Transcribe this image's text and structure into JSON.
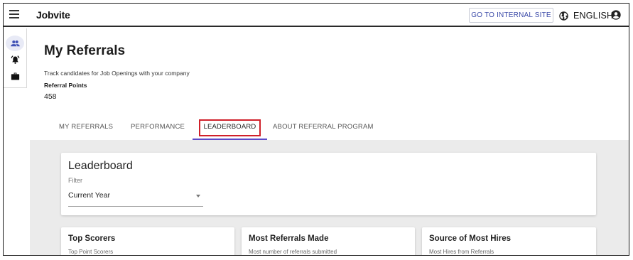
{
  "header": {
    "brand": "Jobvite",
    "internal_site_label": "GO TO INTERNAL SITE",
    "language_label": "ENGLISH"
  },
  "icons": {
    "menu": "hamburger-icon",
    "language": "globe-icon",
    "account": "account-circle-icon",
    "nav_referrals": "people-icon",
    "nav_alerts": "alarm-icon",
    "nav_jobs": "briefcase-icon"
  },
  "page": {
    "title": "My Referrals",
    "subtitle": "Track candidates for Job Openings with your company",
    "points_label": "Referral Points",
    "points_value": "458"
  },
  "tabs": [
    {
      "label": "MY REFERRALS"
    },
    {
      "label": "PERFORMANCE"
    },
    {
      "label": "LEADERBOARD"
    },
    {
      "label": "ABOUT REFERRAL PROGRAM"
    }
  ],
  "active_tab": "LEADERBOARD",
  "leaderboard": {
    "title": "Leaderboard",
    "filter_label": "Filter",
    "filter_value": "Current Year"
  },
  "stats": [
    {
      "title": "Top Scorers",
      "subtitle": "Top Point Scorers"
    },
    {
      "title": "Most Referrals Made",
      "subtitle": "Most number of referrals submitted"
    },
    {
      "title": "Source of Most Hires",
      "subtitle": "Most Hires from Referrals"
    }
  ],
  "colors": {
    "accent": "#5c4ac9",
    "highlight": "#d0202a",
    "link": "#3b4aa8",
    "content_bg": "#ebebeb"
  }
}
